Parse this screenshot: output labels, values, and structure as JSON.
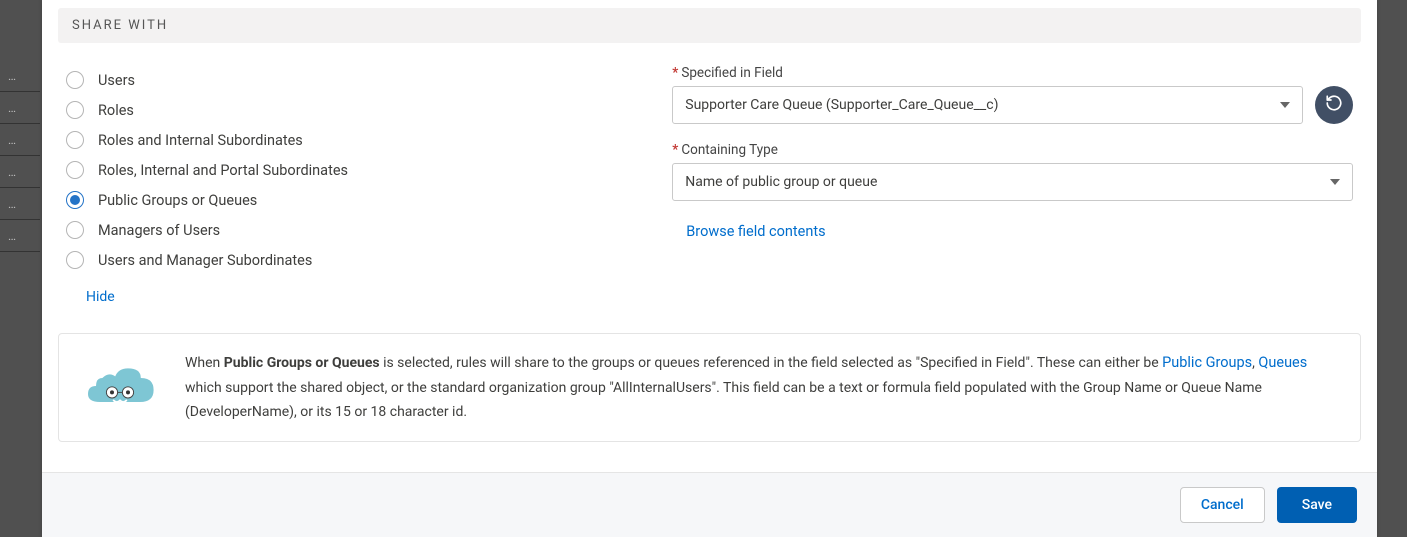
{
  "section_title": "SHARE WITH",
  "radios": {
    "users": "Users",
    "roles": "Roles",
    "roles_internal": "Roles and Internal Subordinates",
    "roles_internal_portal": "Roles, Internal and Portal Subordinates",
    "public_groups_queues": "Public Groups or Queues",
    "managers_of_users": "Managers of Users",
    "users_manager_subs": "Users and Manager Subordinates"
  },
  "hide_label": "Hide",
  "specified": {
    "label": "Specified in Field",
    "value": "Supporter Care Queue (Supporter_Care_Queue__c)"
  },
  "containing": {
    "label": "Containing Type",
    "value": "Name of public group or queue"
  },
  "browse_link": "Browse field contents",
  "info": {
    "pre": "When ",
    "bold": "Public Groups or Queues",
    "mid1": " is selected, rules will share to the groups or queues referenced in the field selected as \"Specified in Field\". These can either be ",
    "link1": "Public Groups",
    "sep": ", ",
    "link2": "Queues",
    "mid2": " which support the shared object, or the standard organization group \"AllInternalUsers\". This field can be a text or formula field populated with the Group Name or Queue Name (DeveloperName), or its 15 or 18 character id."
  },
  "footer": {
    "cancel": "Cancel",
    "save": "Save"
  }
}
